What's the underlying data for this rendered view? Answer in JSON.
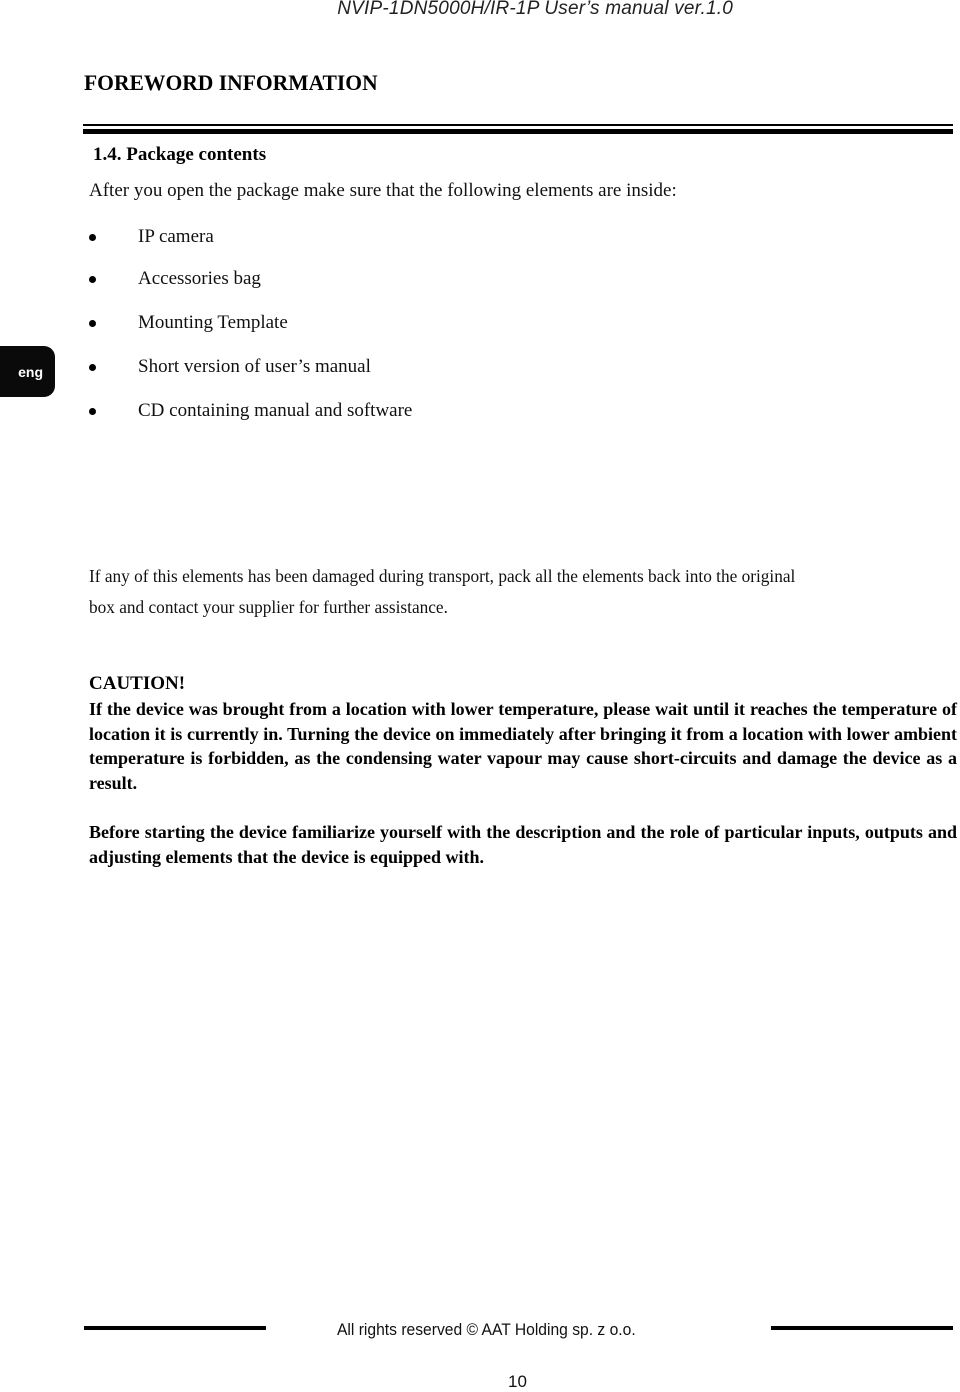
{
  "header": {
    "running_title": "NVIP-1DN5000H/IR-1P User’s manual ver.1.0"
  },
  "chapter": {
    "title": "FOREWORD INFORMATION"
  },
  "language_tab": {
    "label": "eng"
  },
  "section": {
    "heading": "1.4. Package contents",
    "intro": "After you open the package make sure that the following elements are inside:",
    "items": [
      {
        "label": "IP camera"
      },
      {
        "label": "Accessories bag"
      },
      {
        "label": "Mounting Template"
      },
      {
        "label": "Short version of user’s manual"
      },
      {
        "label": "CD containing manual and software"
      }
    ],
    "damage_note_line1": "If any of this elements has been damaged during transport, pack all the elements back into the original",
    "damage_note_line2": "box and contact your supplier for further assistance."
  },
  "caution": {
    "title": "CAUTION!",
    "body": "If the device was brought from a location with lower temperature, please wait until it reaches the temperature of location it is currently in. Turning the device on immediately after bringing it from a location with lower ambient temperature is forbidden, as the condensing water vapour may cause short-circuits and damage the device as a result."
  },
  "before_note": "Before starting the device familiarize yourself with the description and the role of particular inputs, outputs and adjusting elements that the device is equipped with.",
  "footer": {
    "copyright": "All rights reserved © AAT Holding sp. z o.o.",
    "page_number": "10"
  }
}
